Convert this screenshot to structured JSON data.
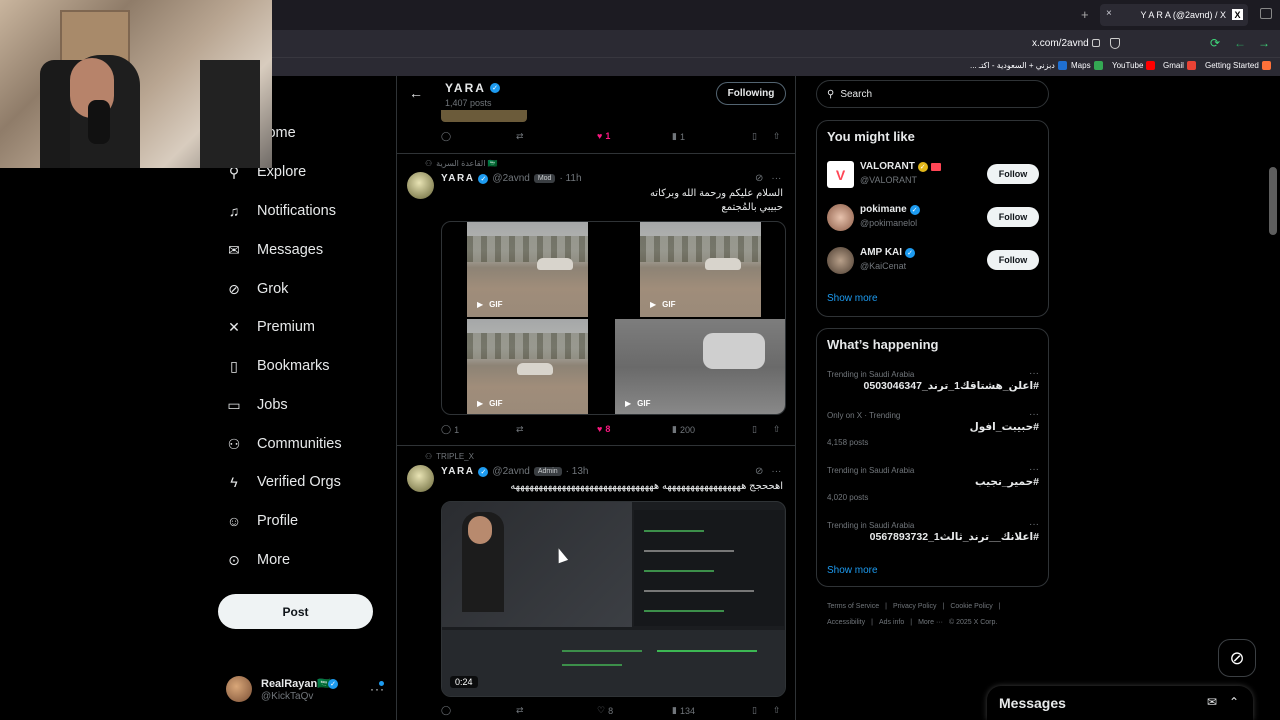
{
  "browser": {
    "tab_title": "Y A R A (@2avnd) / X",
    "tab_close": "×",
    "tab_xlogo": "X",
    "new_tab": "+",
    "url": "x.com/2avnd",
    "bookmarks": [
      {
        "label": "... دبزني + السعودية - اكتـ",
        "color": "#1f6fd1"
      },
      {
        "label": "Maps",
        "color": "#34a853"
      },
      {
        "label": "YouTube",
        "color": "#ff0000"
      },
      {
        "label": "Gmail",
        "color": "#ea4335"
      },
      {
        "label": "Getting Started",
        "color": "#ff7139"
      }
    ]
  },
  "nav": {
    "items": [
      {
        "label": "Home",
        "icon": "home-icon",
        "glyph": "⌂"
      },
      {
        "label": "Explore",
        "icon": "search-icon",
        "glyph": "⚲"
      },
      {
        "label": "Notifications",
        "icon": "bell-icon",
        "glyph": "🔔︎"
      },
      {
        "label": "Messages",
        "icon": "envelope-icon",
        "glyph": "✉"
      },
      {
        "label": "Grok",
        "icon": "grok-icon",
        "glyph": "⊘"
      },
      {
        "label": "Premium",
        "icon": "x-logo-icon",
        "glyph": "𝕏"
      },
      {
        "label": "Bookmarks",
        "icon": "bookmark-icon",
        "glyph": "🔖︎"
      },
      {
        "label": "Jobs",
        "icon": "briefcase-icon",
        "glyph": "💼︎"
      },
      {
        "label": "Communities",
        "icon": "people-icon",
        "glyph": "👥︎"
      },
      {
        "label": "Verified Orgs",
        "icon": "lightning-icon",
        "glyph": "ϟ"
      },
      {
        "label": "Profile",
        "icon": "person-icon",
        "glyph": "👤︎"
      },
      {
        "label": "More",
        "icon": "more-circle-icon",
        "glyph": "⋯"
      }
    ],
    "post_label": "Post",
    "account": {
      "name": "RealRayan🇸🇦",
      "handle": "@KickTaQv"
    }
  },
  "profile": {
    "name": "YARA",
    "posts": "1,407 posts",
    "following_label": "Following"
  },
  "tweets": [
    {
      "reply": "",
      "like": "1",
      "views": "1"
    },
    {
      "context": "القاعدة السرية 🇸🇦",
      "name": "YARA",
      "handle": "@2avnd",
      "badge": "Mod",
      "time": "· 11h",
      "text_line1": "السلام عليكم ورحمة الله وبركاته",
      "text_line2": "حبيبي بالمُجتمع",
      "gif_label": "GIF",
      "reply": "1",
      "like": "8",
      "views": "200"
    },
    {
      "context": "TRIPLE_X",
      "name": "YARA",
      "handle": "@2avnd",
      "badge": "Admin",
      "time": "· 13h",
      "text_line1": "اهححجج هههههههههههههههههه هههههههههههههههههههههههههههههههه",
      "duration": "0:24",
      "reply": "",
      "like": "8",
      "views": "134"
    }
  ],
  "right": {
    "search_placeholder": "Search",
    "might_like_title": "You might like",
    "suggestions": [
      {
        "name": "VALORANT",
        "handle": "@VALORANT",
        "follow": "Follow",
        "color": "#ff4655"
      },
      {
        "name": "pokimane",
        "handle": "@pokimanelol",
        "follow": "Follow",
        "color": "#c98f7a"
      },
      {
        "name": "AMP KAI",
        "handle": "@KaiCenat",
        "follow": "Follow",
        "color": "#6b5745"
      }
    ],
    "show_more": "Show more",
    "happening_title": "What’s happening",
    "trends": [
      {
        "context": "Trending in Saudi Arabia",
        "tag": "#اعلن_هشتاقك1_ترند_0503046347",
        "count": ""
      },
      {
        "context": "Only on X · Trending",
        "tag": "#حبيبت_افول",
        "count": "4,158 posts"
      },
      {
        "context": "Trending in Saudi Arabia",
        "tag": "#حمير_نجيب",
        "count": "4,020 posts"
      },
      {
        "context": "Trending in Saudi Arabia",
        "tag": "#اعلانك__ترند_ثالث1_0567893732",
        "count": ""
      }
    ],
    "footer_row1": [
      "Terms of Service",
      "|",
      "Privacy Policy",
      "|",
      "Cookie Policy",
      "|"
    ],
    "footer_row2": [
      "Accessibility",
      "|",
      "Ads info",
      "|",
      "More ···",
      "© 2025 X Corp."
    ],
    "messages_title": "Messages"
  }
}
